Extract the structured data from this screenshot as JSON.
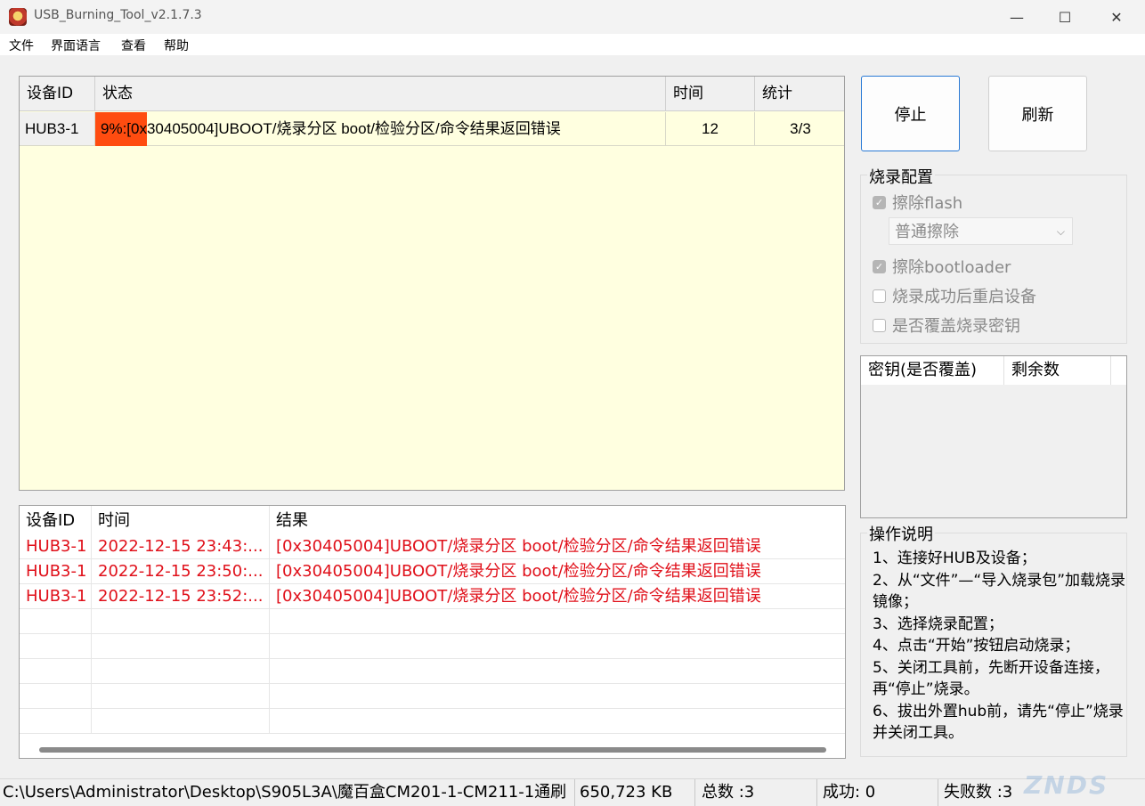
{
  "window": {
    "title": "USB_Burning_Tool_v2.1.7.3",
    "minimize_glyph": "—",
    "maximize_glyph": "☐",
    "close_glyph": "✕"
  },
  "menu": [
    "文件",
    "界面语言",
    "查看",
    "帮助"
  ],
  "device_table": {
    "headers": [
      "设备ID",
      "状态",
      "时间",
      "统计"
    ],
    "rows": [
      {
        "device_id": "HUB3-1",
        "status": "9%:[0x30405004]UBOOT/烧录分区 boot/检验分区/命令结果返回错误",
        "progress": 9,
        "time": "12",
        "stats": "3/3"
      }
    ]
  },
  "buttons": {
    "stop": "停止",
    "refresh": "刷新"
  },
  "burn_config": {
    "title": "烧录配置",
    "erase_flash": {
      "label": "擦除flash",
      "checked": true
    },
    "erase_mode": "普通擦除",
    "erase_bootloader": {
      "label": "擦除bootloader",
      "checked": true
    },
    "reboot_after": {
      "label": "烧录成功后重启设备",
      "checked": false
    },
    "overwrite_key": {
      "label": "是否覆盖烧录密钥",
      "checked": false
    }
  },
  "key_table": {
    "headers": [
      "密钥(是否覆盖)",
      "剩余数"
    ]
  },
  "instructions": {
    "title": "操作说明",
    "lines": [
      "1、连接好HUB及设备；",
      "2、从“文件”—“导入烧录包”加载烧录镜像；",
      "3、选择烧录配置；",
      "4、点击“开始”按钮启动烧录；",
      "5、关闭工具前，先断开设备连接，再“停止”烧录。",
      "6、拔出外置hub前，请先“停止”烧录并关闭工具。"
    ]
  },
  "log_table": {
    "headers": [
      "设备ID",
      "时间",
      "结果"
    ],
    "rows": [
      {
        "device_id": "HUB3-1",
        "time": "2022-12-15 23:43:...",
        "result": "[0x30405004]UBOOT/烧录分区 boot/检验分区/命令结果返回错误"
      },
      {
        "device_id": "HUB3-1",
        "time": "2022-12-15 23:50:...",
        "result": "[0x30405004]UBOOT/烧录分区 boot/检验分区/命令结果返回错误"
      },
      {
        "device_id": "HUB3-1",
        "time": "2022-12-15 23:52:...",
        "result": "[0x30405004]UBOOT/烧录分区 boot/检验分区/命令结果返回错误"
      }
    ],
    "error_color": "#e0101a"
  },
  "statusbar": {
    "path": "C:\\Users\\Administrator\\Desktop\\S905L3A\\魔百盒CM201-1-CM211-1通刷",
    "size": "650,723 KB",
    "total": "总数 :3",
    "success": "成功:  0",
    "failed": "失败数 :3"
  },
  "watermark": "ZNDS",
  "colors": {
    "progress": "#ff4c10",
    "table_bg": "#ffffe0",
    "focus_border": "#2a7ad5"
  }
}
